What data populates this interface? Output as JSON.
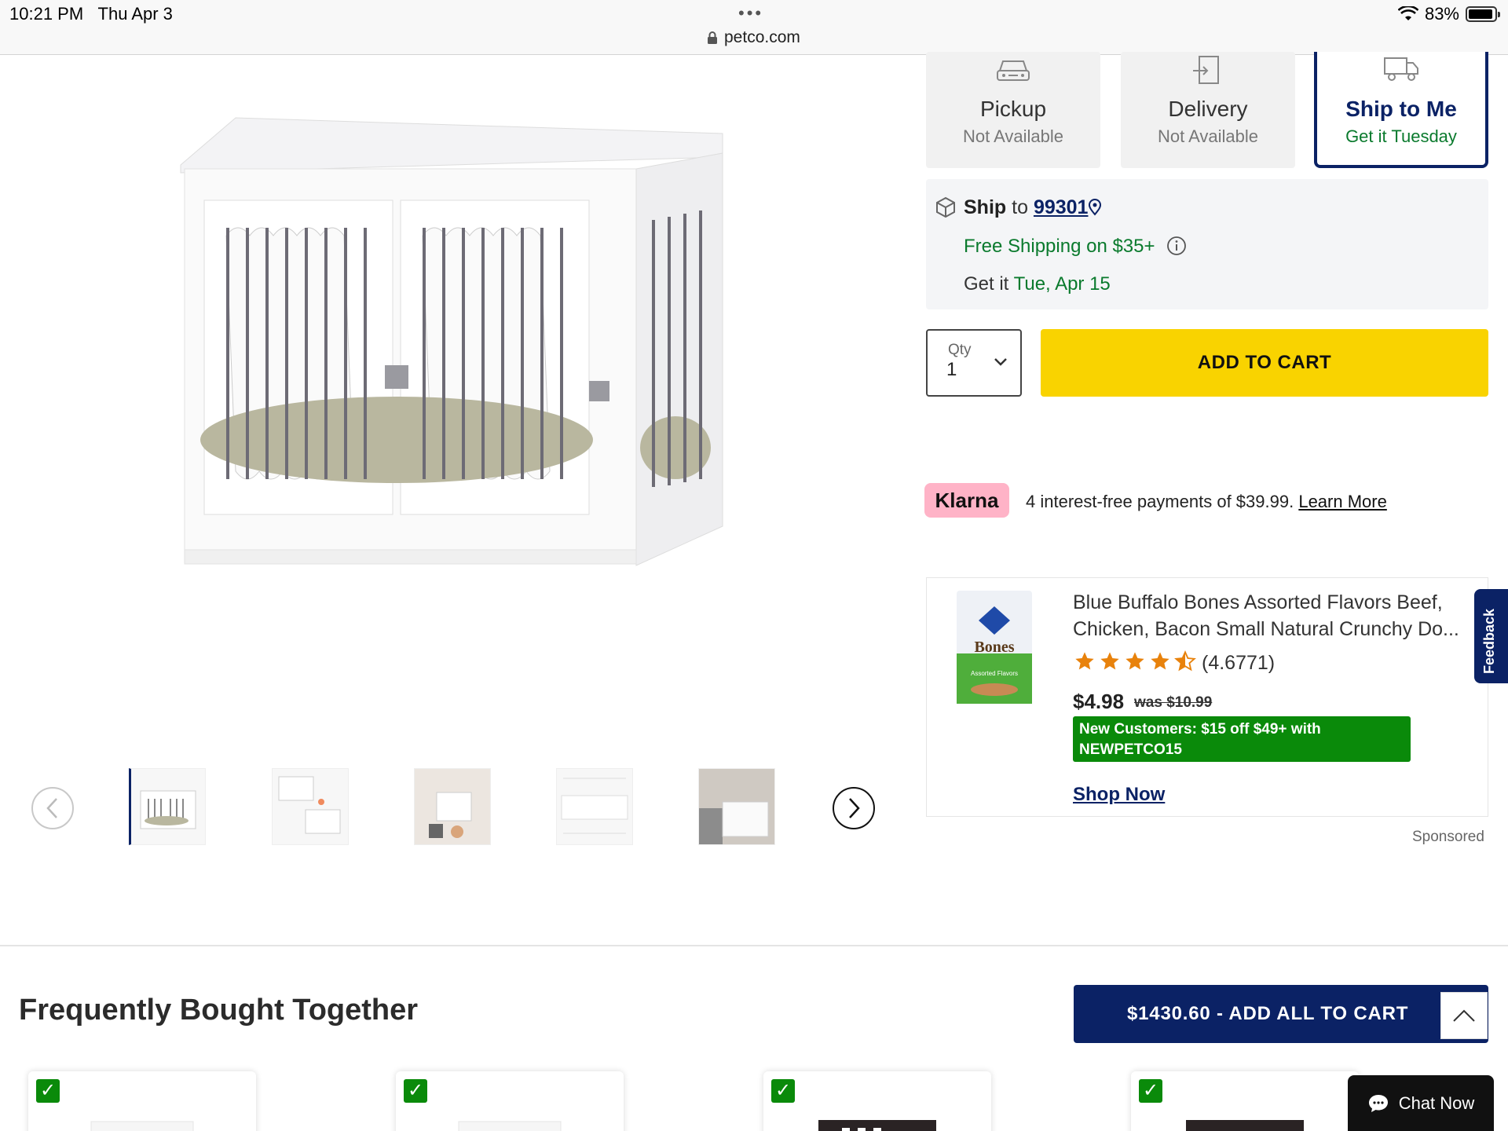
{
  "status_bar": {
    "time": "10:21 PM",
    "date": "Thu Apr 3",
    "url": "petco.com",
    "battery": "83%"
  },
  "fulfillment": {
    "pickup": {
      "title": "Pickup",
      "status": "Not Available"
    },
    "delivery": {
      "title": "Delivery",
      "status": "Not Available"
    },
    "ship": {
      "title": "Ship to Me",
      "status": "Get it Tuesday"
    }
  },
  "shipping": {
    "ship_label": "Ship",
    "to_word": "to",
    "zip": "99301",
    "free_shipping": "Free Shipping on $35+",
    "get_it_prefix": "Get it",
    "get_it_date": "Tue, Apr 15"
  },
  "qty": {
    "label": "Qty",
    "value": "1"
  },
  "add_to_cart_label": "ADD TO CART",
  "klarna": {
    "badge": "Klarna",
    "text": "4 interest-free payments of $39.99.",
    "link": "Learn More"
  },
  "sponsored_ad": {
    "title_line1": "Blue Buffalo Bones Assorted Flavors Beef,",
    "title_line2": "Chicken, Bacon Small Natural Crunchy Do...",
    "rating_value": 4.6771,
    "rating_text": "(4.6771)",
    "price": "$4.98",
    "was_price": "was $10.99",
    "promo_line1": "New Customers: $15 off $49+ with",
    "promo_line2": "NEWPETCO15",
    "shop_now": "Shop Now",
    "sponsored_label": "Sponsored",
    "package_label": "Bones",
    "package_sub": "Assorted Flavors"
  },
  "feedback_label": "Feedback",
  "frequently_bought": {
    "title": "Frequently Bought Together",
    "add_all_label": "$1430.60 - ADD ALL TO CART"
  },
  "chat_label": "Chat Now",
  "gallery": {
    "active_index": 0,
    "thumb_count": 5
  },
  "colors": {
    "brand_navy": "#0b2265",
    "cta_yellow": "#f9d300",
    "success_green": "#0a7a2d",
    "klarna_pink": "#ffb3c7"
  },
  "icons": [
    "lock-icon",
    "wifi-icon",
    "battery-icon",
    "car-icon",
    "delivery-box-icon",
    "truck-icon",
    "package-icon",
    "location-pin-icon",
    "info-icon",
    "chevron-down-icon",
    "star-icon",
    "half-star-icon",
    "chevron-left-icon",
    "chevron-right-icon",
    "chevron-up-icon",
    "chat-bubble-icon",
    "checkmark-icon"
  ]
}
